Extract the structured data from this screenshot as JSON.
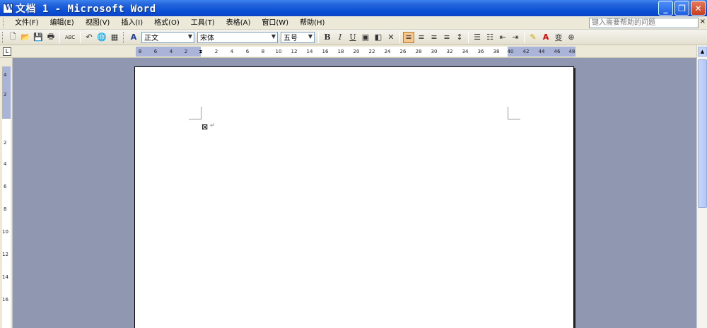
{
  "window": {
    "title": "文档 1 - Microsoft Word",
    "controls": {
      "minimize": "_",
      "restore": "❐",
      "close": "✕"
    }
  },
  "menu": {
    "items": [
      "文件(F)",
      "编辑(E)",
      "视图(V)",
      "插入(I)",
      "格式(O)",
      "工具(T)",
      "表格(A)",
      "窗口(W)",
      "帮助(H)"
    ],
    "help_placeholder": "键入需要帮助的问题",
    "close_doc": "×"
  },
  "toolbar": {
    "style_value": "正文",
    "font_value": "宋体",
    "size_value": "五号",
    "bold": "B",
    "italic": "I",
    "underline": "U",
    "icons": {
      "new": "🗋",
      "open": "📂",
      "save": "💾",
      "print": "🖶",
      "spell": "ABC",
      "undo": "↶",
      "hyperlink": "🌐",
      "table": "▦",
      "style_icon": "A"
    }
  },
  "ruler": {
    "tab_selector": "L",
    "left_labels": [
      "8",
      "6",
      "4",
      "2"
    ],
    "right_labels": [
      "2",
      "4",
      "6",
      "8",
      "10",
      "12",
      "14",
      "16",
      "18",
      "20",
      "22",
      "24",
      "26",
      "28",
      "30",
      "32",
      "34",
      "36",
      "38",
      "40",
      "42",
      "44",
      "46",
      "48"
    ],
    "vertical_labels": [
      "4",
      "2",
      "2",
      "4",
      "6",
      "8",
      "10",
      "12",
      "14",
      "16"
    ]
  },
  "document": {
    "cursor_glyph": "⊠",
    "para_mark": "↵"
  }
}
